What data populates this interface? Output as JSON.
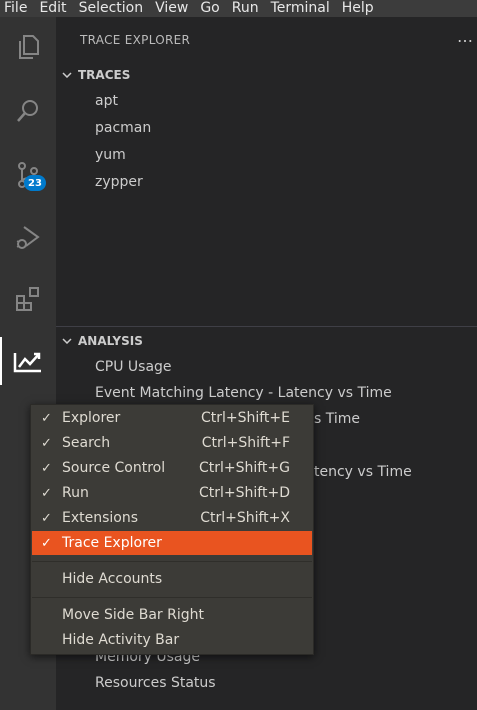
{
  "menubar": [
    "File",
    "Edit",
    "Selection",
    "View",
    "Go",
    "Run",
    "Terminal",
    "Help"
  ],
  "activity_bar": {
    "source_control_badge": "23"
  },
  "sidebar": {
    "title": "TRACE EXPLORER",
    "more_icon": "…",
    "traces": {
      "header": "TRACES",
      "items": [
        "apt",
        "pacman",
        "yum",
        "zypper"
      ]
    },
    "analysis": {
      "header": "ANALYSIS",
      "items": [
        "CPU Usage",
        "Event Matching Latency - Latency vs Time",
        "s Time",
        "tency vs Time",
        "Memory Usage",
        "Resources Status"
      ]
    }
  },
  "context_menu": {
    "items": [
      {
        "label": "Explorer",
        "accel": "Ctrl+Shift+E",
        "checked": "✓"
      },
      {
        "label": "Search",
        "accel": "Ctrl+Shift+F",
        "checked": "✓"
      },
      {
        "label": "Source Control",
        "accel": "Ctrl+Shift+G",
        "checked": "✓"
      },
      {
        "label": "Run",
        "accel": "Ctrl+Shift+D",
        "checked": "✓"
      },
      {
        "label": "Extensions",
        "accel": "Ctrl+Shift+X",
        "checked": "✓"
      },
      {
        "label": "Trace Explorer",
        "accel": "",
        "checked": "✓"
      }
    ],
    "hide_accounts": "Hide Accounts",
    "move_side_bar": "Move Side Bar Right",
    "hide_activity_bar": "Hide Activity Bar"
  },
  "colors": {
    "accent": "#e95420",
    "badge": "#007acc"
  }
}
